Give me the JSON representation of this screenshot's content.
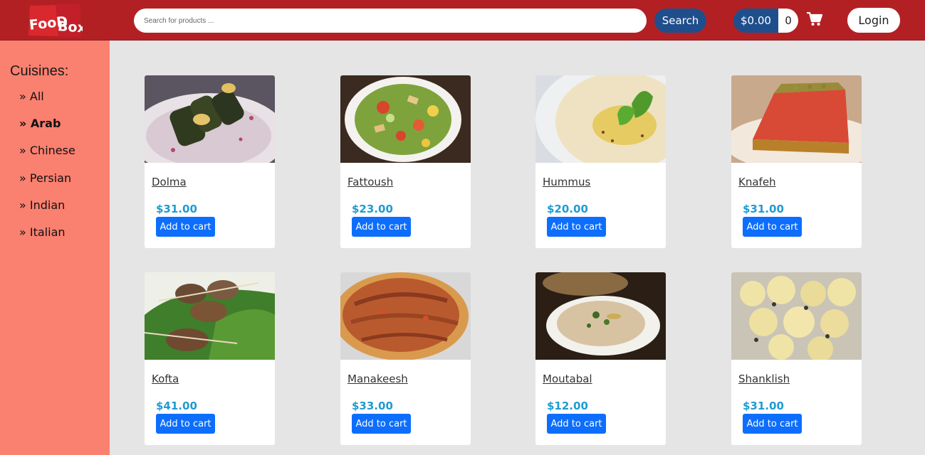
{
  "header": {
    "logo_text": "FooD Box",
    "search_placeholder": "Search for products ...",
    "search_label": "Search",
    "cart_total": "$0.00",
    "cart_count": "0",
    "login_label": "Login"
  },
  "sidebar": {
    "title": "Cuisines:",
    "items": [
      {
        "label": "» All"
      },
      {
        "label": "» Arab"
      },
      {
        "label": "» Chinese"
      },
      {
        "label": "» Persian"
      },
      {
        "label": "» Indian"
      },
      {
        "label": "» Italian"
      }
    ],
    "active_item": "Arab"
  },
  "products": [
    {
      "name": "Dolma",
      "price": "$31.00",
      "button": "Add to cart"
    },
    {
      "name": "Fattoush",
      "price": "$23.00",
      "button": "Add to cart"
    },
    {
      "name": "Hummus",
      "price": "$20.00",
      "button": "Add to cart"
    },
    {
      "name": "Knafeh",
      "price": "$31.00",
      "button": "Add to cart"
    },
    {
      "name": "Kofta",
      "price": "$41.00",
      "button": "Add to cart"
    },
    {
      "name": "Manakeesh",
      "price": "$33.00",
      "button": "Add to cart"
    },
    {
      "name": "Moutabal",
      "price": "$12.00",
      "button": "Add to cart"
    },
    {
      "name": "Shanklish",
      "price": "$31.00",
      "button": "Add to cart"
    }
  ],
  "colors": {
    "header": "#b32024",
    "sidebar": "#fa8070",
    "background": "#e5e5e5",
    "primary_button": "#0d6efd",
    "dark_button": "#1f4e8c",
    "price": "#1f9bd1"
  }
}
